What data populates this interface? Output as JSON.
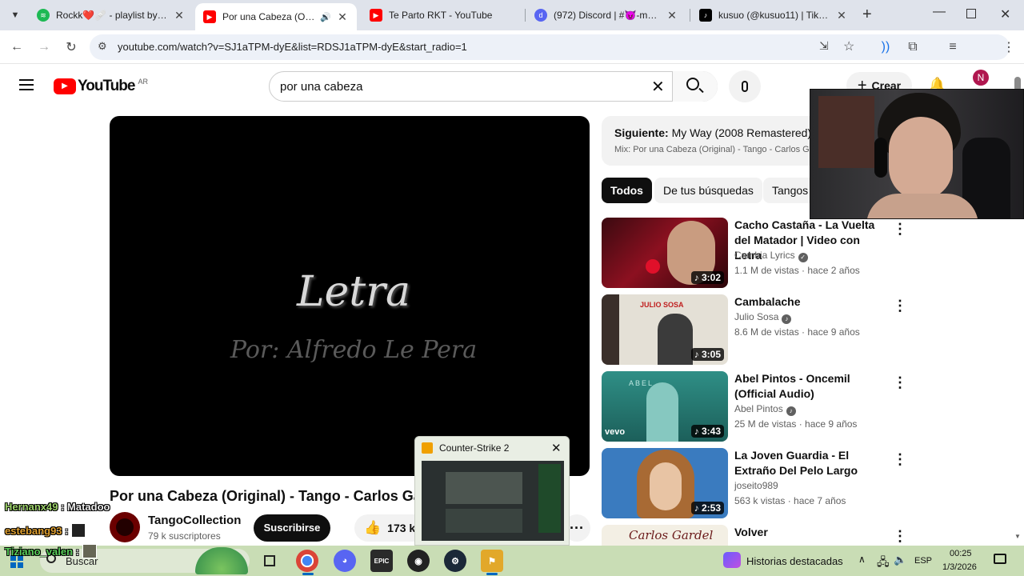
{
  "browser": {
    "tabs": [
      {
        "title": "Rockk❤️🩹 - playlist by nat",
        "favicon": "spotify-icon",
        "color": "#1db954"
      },
      {
        "title": "Por una Cabeza (Original",
        "favicon": "youtube-icon",
        "color": "#ff0000",
        "active": true
      },
      {
        "title": "Te Parto RKT - YouTube",
        "favicon": "youtube-icon",
        "color": "#ff0000"
      },
      {
        "title": "(972) Discord | #😈-memes",
        "favicon": "discord-icon",
        "color": "#5865f2"
      },
      {
        "title": "kusuo (@kusuo11) | TikTok",
        "favicon": "tiktok-icon",
        "color": "#000000"
      }
    ],
    "url": "youtube.com/watch?v=SJ1aTPM-dyE&list=RDSJ1aTPM-dyE&start_radio=1",
    "profile_initial": "N"
  },
  "youtube": {
    "logo_text": "YouTube",
    "region": "AR",
    "search_value": "por una cabeza",
    "create_label": "Crear",
    "video": {
      "overlay_title": "Letra",
      "overlay_subtitle": "Por: Alfredo Le Pera",
      "title": "Por una Cabeza (Original) - Tango - Carlos Ga",
      "channel": "TangoCollection",
      "subscribers": "79 k suscriptores",
      "subscribe_label": "Suscribirse",
      "likes": "173 k"
    },
    "up_next": {
      "label": "Siguiente:",
      "title": "My Way (2008 Remastered)",
      "mix": "Mix: Por una Cabeza (Original) - Tango - Carlos Ga"
    },
    "chips": [
      "Todos",
      "De tus búsquedas",
      "Tangos"
    ],
    "recommendations": [
      {
        "title": "Cacho Castaña - La Vuelta del Matador | Video con Letra",
        "channel": "Cumbia Lyrics",
        "meta": "1.1 M de vistas · hace 2 años",
        "duration": "3:02"
      },
      {
        "title": "Cambalache",
        "channel": "Julio Sosa",
        "meta": "8.6 M de vistas · hace 9 años",
        "duration": "3:05",
        "thumb_text": "JULIO SOSA"
      },
      {
        "title": "Abel Pintos - Oncemil (Official Audio)",
        "channel": "Abel Pintos",
        "meta": "25 M de vistas · hace 9 años",
        "duration": "3:43",
        "thumb_text": "ABEL",
        "thumb_brand": "vevo"
      },
      {
        "title": "La Joven Guardia - El Extraño Del Pelo Largo",
        "channel": "joseito989",
        "meta": "563 k vistas · hace 7 años",
        "duration": "2:53"
      },
      {
        "title": "Volver",
        "channel": "",
        "meta": "",
        "duration": "",
        "thumb_text": "Carlos Gardel"
      }
    ]
  },
  "popup": {
    "title": "Counter-Strike 2"
  },
  "chat": [
    {
      "user": "Hernanx49",
      "message": "Matadoo",
      "color": "#9fd36c"
    },
    {
      "user": "estebang93",
      "message": "",
      "color": "#e0a030"
    },
    {
      "user": "Tiziano_valen",
      "message": "",
      "color": "#5bd05b"
    }
  ],
  "taskbar": {
    "search_label": "Buscar",
    "widget_label": "Historias destacadas",
    "language": "ESP",
    "time": "00:25",
    "date": "1/3/2026"
  }
}
